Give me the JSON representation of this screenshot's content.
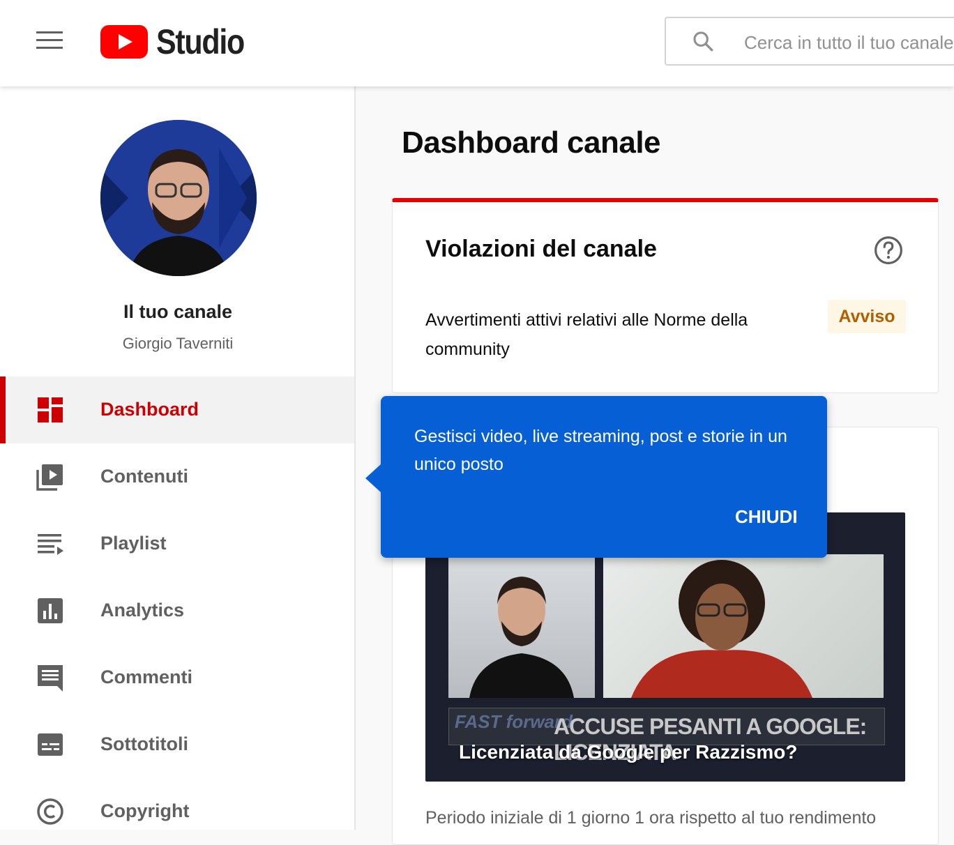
{
  "header": {
    "logo_text": "Studio",
    "search_placeholder": "Cerca in tutto il tuo canale"
  },
  "sidebar": {
    "channel_title": "Il tuo canale",
    "channel_owner": "Giorgio Taverniti",
    "items": [
      {
        "label": "Dashboard",
        "icon": "dashboard-icon",
        "active": true
      },
      {
        "label": "Contenuti",
        "icon": "content-icon",
        "active": false
      },
      {
        "label": "Playlist",
        "icon": "playlist-icon",
        "active": false
      },
      {
        "label": "Analytics",
        "icon": "analytics-icon",
        "active": false
      },
      {
        "label": "Commenti",
        "icon": "comments-icon",
        "active": false
      },
      {
        "label": "Sottotitoli",
        "icon": "subtitles-icon",
        "active": false
      },
      {
        "label": "Copyright",
        "icon": "copyright-icon",
        "active": false
      }
    ]
  },
  "main": {
    "page_title": "Dashboard canale",
    "violations_card": {
      "title": "Violazioni del canale",
      "text": "Avvertimenti attivi relativi alle Norme della community",
      "badge": "Avviso"
    },
    "video_card": {
      "thumbnail_banner": "ACCUSE PESANTI A GOOGLE: LICENZIATA",
      "thumbnail_brand": "FAST forward",
      "video_title": "Licenziata da Google per Razzismo?",
      "footer_text": "Periodo iniziale di 1 giorno 1 ora rispetto al tuo rendimento"
    }
  },
  "tooltip": {
    "text": "Gestisci video, live streaming, post e storie in un unico posto",
    "close_label": "CHIUDI"
  },
  "colors": {
    "brand_red": "#ff0000",
    "active_red": "#cc0000",
    "tooltip_blue": "#065fd4",
    "warning_text": "#b06000",
    "warning_bg": "#fef7e6"
  }
}
